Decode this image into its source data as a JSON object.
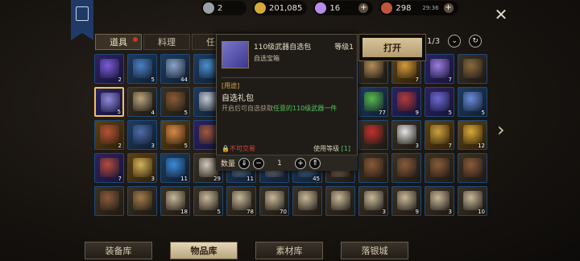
{
  "topbar": {
    "currencies": [
      {
        "icon": "silver-coin-icon",
        "color": "#9aa0a6",
        "value": "2",
        "plus": false
      },
      {
        "icon": "gold-coin-icon",
        "color": "#d7a83a",
        "value": "201,085",
        "plus": false
      },
      {
        "icon": "gem-icon",
        "color": "#b88cf0",
        "value": "16",
        "plus": true
      },
      {
        "icon": "ticket-icon",
        "color": "#c0553a",
        "value": "298",
        "time": "29:36",
        "plus": true
      }
    ]
  },
  "tabs": [
    {
      "label": "道具",
      "active": true,
      "dot": true
    },
    {
      "label": "料理",
      "active": false,
      "dot": false
    },
    {
      "label": "任务",
      "active": false,
      "dot": false
    }
  ],
  "pager": {
    "text": "1/3"
  },
  "popup": {
    "name": "110级武器自选包",
    "level": "等级1",
    "type": "自选宝箱",
    "usage_header": "[用途]",
    "usage_title": "自选礼包",
    "desc_before": "开启后可自选获取",
    "desc_highlight": "任意的110级武器一件",
    "trade": "不可交易",
    "req_label": "使用等级",
    "req_value": "[1]",
    "qty_label": "数量",
    "qty_value": "1"
  },
  "open_button": {
    "label": "打开"
  },
  "items": [
    {
      "q": "q2",
      "c": "#7b5bd6",
      "n": "2"
    },
    {
      "q": "q3",
      "c": "#4b7fc4",
      "n": "5"
    },
    {
      "q": "q3",
      "c": "#8ea5c8",
      "n": "44"
    },
    {
      "q": "q3",
      "c": "#4a8fd0",
      "n": ""
    },
    {
      "q": "",
      "c": "",
      "n": ""
    },
    {
      "q": "",
      "c": "",
      "n": ""
    },
    {
      "q": "",
      "c": "",
      "n": ""
    },
    {
      "q": "",
      "c": "",
      "n": ""
    },
    {
      "q": "q1",
      "c": "#b58d5a",
      "n": ""
    },
    {
      "q": "q4",
      "c": "#d29b3a",
      "n": "7"
    },
    {
      "q": "q2",
      "c": "#9c7de0",
      "n": "7"
    },
    {
      "q": "q1",
      "c": "#8a6a3e",
      "n": ""
    },
    {
      "q": "q2",
      "c": "#8f88d8",
      "n": "5",
      "sel": true
    },
    {
      "q": "q1",
      "c": "#b9a37c",
      "n": "4"
    },
    {
      "q": "q1",
      "c": "#8a5a36",
      "n": "5"
    },
    {
      "q": "q3",
      "c": "#c5c9cf",
      "n": ""
    },
    {
      "q": "",
      "c": "",
      "n": ""
    },
    {
      "q": "",
      "c": "",
      "n": ""
    },
    {
      "q": "",
      "c": "",
      "n": ""
    },
    {
      "q": "",
      "c": "",
      "n": ""
    },
    {
      "q": "q3",
      "c": "#57b84a",
      "n": "77"
    },
    {
      "q": "q2",
      "c": "#b53a3a",
      "n": "9"
    },
    {
      "q": "q2",
      "c": "#6a6ad0",
      "n": "5"
    },
    {
      "q": "q3",
      "c": "#6a8ad8",
      "n": "5"
    },
    {
      "q": "q4",
      "c": "#b5523a",
      "n": "2"
    },
    {
      "q": "q3",
      "c": "#4e6aa8",
      "n": "3"
    },
    {
      "q": "q4",
      "c": "#d6884a",
      "n": "5"
    },
    {
      "q": "q2",
      "c": "#a05a3a",
      "n": ""
    },
    {
      "q": "",
      "c": "",
      "n": ""
    },
    {
      "q": "",
      "c": "",
      "n": ""
    },
    {
      "q": "",
      "c": "",
      "n": ""
    },
    {
      "q": "",
      "c": "",
      "n": ""
    },
    {
      "q": "q1",
      "c": "#c23030",
      "n": ""
    },
    {
      "q": "q1",
      "c": "#e5e5e5",
      "n": "3"
    },
    {
      "q": "q4",
      "c": "#caa140",
      "n": "7"
    },
    {
      "q": "q4",
      "c": "#d7a83a",
      "n": "12"
    },
    {
      "q": "q2",
      "c": "#b54a3a",
      "n": "7"
    },
    {
      "q": "q4",
      "c": "#d3b25a",
      "n": "3"
    },
    {
      "q": "q3",
      "c": "#3a8ad8",
      "n": "11"
    },
    {
      "q": "q1",
      "c": "#d0c8b8",
      "n": "29"
    },
    {
      "q": "q3",
      "c": "#7aa0c8",
      "n": "11"
    },
    {
      "q": "q3",
      "c": "#a0a0a0",
      "n": ""
    },
    {
      "q": "q3",
      "c": "#5a8ab8",
      "n": "45"
    },
    {
      "q": "q1",
      "c": "#a89070",
      "n": ""
    },
    {
      "q": "q1",
      "c": "#8a5a3a",
      "n": ""
    },
    {
      "q": "q1",
      "c": "#8a5a3a",
      "n": ""
    },
    {
      "q": "q1",
      "c": "#8a5a3a",
      "n": ""
    },
    {
      "q": "q1",
      "c": "#8a5a3a",
      "n": ""
    },
    {
      "q": "q1",
      "c": "#8a5a3a",
      "n": ""
    },
    {
      "q": "q1",
      "c": "#a07a4a",
      "n": ""
    },
    {
      "q": "q1",
      "c": "#c8b89a",
      "n": "18"
    },
    {
      "q": "q1",
      "c": "#c8b89a",
      "n": "5"
    },
    {
      "q": "q1",
      "c": "#c8b89a",
      "n": "78"
    },
    {
      "q": "q1",
      "c": "#c8b89a",
      "n": "70"
    },
    {
      "q": "q1",
      "c": "#c8b89a",
      "n": ""
    },
    {
      "q": "q1",
      "c": "#c8b89a",
      "n": ""
    },
    {
      "q": "q1",
      "c": "#c8b89a",
      "n": "3"
    },
    {
      "q": "q1",
      "c": "#c8b89a",
      "n": "9"
    },
    {
      "q": "q1",
      "c": "#c8b89a",
      "n": "3"
    },
    {
      "q": "q1",
      "c": "#c8b89a",
      "n": "10"
    }
  ],
  "bottom_tabs": [
    {
      "label": "装备库",
      "active": false
    },
    {
      "label": "物品库",
      "active": true
    },
    {
      "label": "素材库",
      "active": false
    },
    {
      "label": "落银城",
      "active": false
    }
  ]
}
